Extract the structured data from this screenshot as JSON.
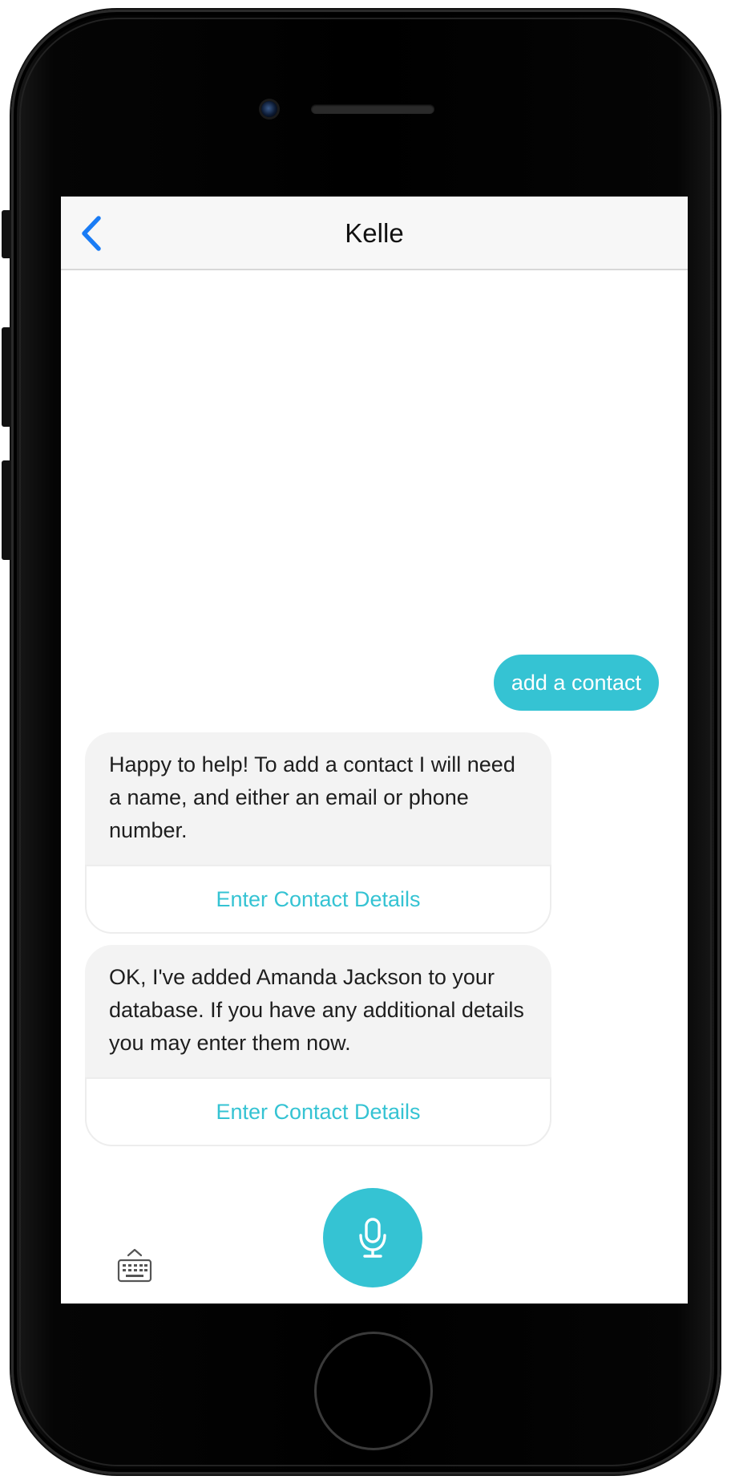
{
  "device": {
    "name": "iPhone frame"
  },
  "nav": {
    "title": "Kelle",
    "back_icon": "chevron-left-icon",
    "back_color": "#1a7cf5"
  },
  "conversation": {
    "user_message": "add a contact",
    "bot_messages": [
      {
        "text": "Happy to help! To add a contact I will need a name, and either an email or phone number.",
        "action_label": "Enter Contact Details"
      },
      {
        "text": "OK, I've added Amanda Jackson to your database. If you have any additional details you may enter them now.",
        "action_label": "Enter Contact Details"
      }
    ]
  },
  "input_bar": {
    "keyboard_icon": "keyboard-icon",
    "mic_icon": "microphone-icon"
  },
  "colors": {
    "accent": "#35c3d3",
    "bot_bubble": "#f3f3f3",
    "nav_background": "#f7f7f7"
  }
}
